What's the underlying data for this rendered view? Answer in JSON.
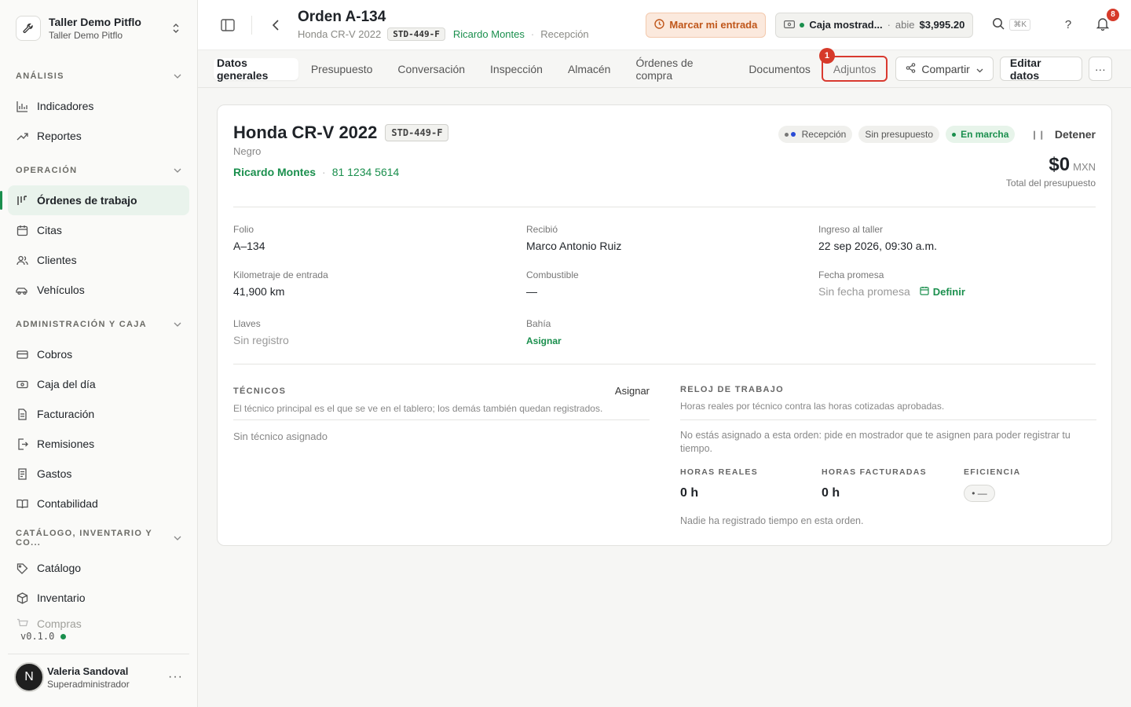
{
  "org": {
    "name": "Taller Demo Pitflo",
    "sub": "Taller Demo Pitflo"
  },
  "sidebar": {
    "sections": [
      {
        "title": "ANÁLISIS",
        "items": [
          {
            "label": "Indicadores",
            "icon": "bar-chart-icon"
          },
          {
            "label": "Reportes",
            "icon": "trend-up-icon"
          }
        ]
      },
      {
        "title": "OPERACIÓN",
        "items": [
          {
            "label": "Órdenes de trabajo",
            "icon": "kanban-icon",
            "active": true
          },
          {
            "label": "Citas",
            "icon": "calendar-icon"
          },
          {
            "label": "Clientes",
            "icon": "users-icon"
          },
          {
            "label": "Vehículos",
            "icon": "car-icon"
          }
        ]
      },
      {
        "title": "ADMINISTRACIÓN Y CAJA",
        "items": [
          {
            "label": "Cobros",
            "icon": "credit-card-icon"
          },
          {
            "label": "Caja del día",
            "icon": "cash-icon"
          },
          {
            "label": "Facturación",
            "icon": "document-icon"
          },
          {
            "label": "Remisiones",
            "icon": "file-export-icon"
          },
          {
            "label": "Gastos",
            "icon": "receipt-icon"
          },
          {
            "label": "Contabilidad",
            "icon": "book-icon"
          }
        ]
      },
      {
        "title": "CATÁLOGO, INVENTARIO Y CO...",
        "items": [
          {
            "label": "Catálogo",
            "icon": "tag-icon"
          },
          {
            "label": "Inventario",
            "icon": "box-icon"
          },
          {
            "label": "Compras",
            "icon": "cart-icon",
            "faded": true
          }
        ]
      }
    ],
    "version": "v0.1.0",
    "user": {
      "initial": "N",
      "name": "Valeria Sandoval",
      "role": "Superadministrador"
    }
  },
  "header": {
    "title": "Orden A-134",
    "vehicle": "Honda CR-V 2022",
    "plate": "STD-449-F",
    "customer": "Ricardo Montes",
    "stage": "Recepción",
    "entry_button": "Marcar mi entrada",
    "cash": {
      "name": "Caja mostrad...",
      "status": "abie",
      "amount": "$3,995.20"
    },
    "search_shortcut": "⌘K",
    "help": "?",
    "notifications": "8"
  },
  "tabs": [
    {
      "label": "Datos generales",
      "active": true
    },
    {
      "label": "Presupuesto"
    },
    {
      "label": "Conversación"
    },
    {
      "label": "Inspección"
    },
    {
      "label": "Almacén"
    },
    {
      "label": "Órdenes de compra"
    },
    {
      "label": "Documentos"
    },
    {
      "label": "Adjuntos",
      "highlight": true
    }
  ],
  "highlight_marker": "1",
  "actions": {
    "share": "Compartir",
    "edit": "Editar datos",
    "more": "···"
  },
  "card": {
    "vehicle": "Honda CR-V 2022",
    "plate": "STD-449-F",
    "color": "Negro",
    "customer": "Ricardo Montes",
    "phone": "81 1234 5614",
    "pills": {
      "stage": "Recepción",
      "budget": "Sin presupuesto",
      "status": "En marcha"
    },
    "stop": "Detener",
    "total": {
      "amount": "$0",
      "currency": "MXN",
      "label": "Total del presupuesto"
    },
    "fields": {
      "folio": {
        "label": "Folio",
        "value": "A–134"
      },
      "received": {
        "label": "Recibió",
        "value": "Marco Antonio Ruiz"
      },
      "entry": {
        "label": "Ingreso al taller",
        "value": "22 sep 2026, 09:30 a.m."
      },
      "mileage": {
        "label": "Kilometraje de entrada",
        "value": "41,900 km"
      },
      "fuel": {
        "label": "Combustible",
        "value": "—"
      },
      "promise": {
        "label": "Fecha promesa",
        "value": "Sin fecha promesa",
        "action": "Definir"
      },
      "keys": {
        "label": "Llaves",
        "value": "Sin registro"
      },
      "bay": {
        "label": "Bahía",
        "action": "Asignar"
      }
    },
    "techs": {
      "title": "TÉCNICOS",
      "assign": "Asignar",
      "help": "El técnico principal es el que se ve en el tablero; los demás también quedan registrados.",
      "empty": "Sin técnico asignado"
    },
    "clock": {
      "title": "RELOJ DE TRABAJO",
      "help": "Horas reales por técnico contra las horas cotizadas aprobadas.",
      "notice": "No estás asignado a esta orden: pide en mostrador que te asignen para poder registrar tu tiempo.",
      "real_label": "HORAS REALES",
      "real_value": "0 h",
      "billed_label": "HORAS FACTURADAS",
      "billed_value": "0 h",
      "eff_label": "EFICIENCIA",
      "eff_value": "• —",
      "footer": "Nadie ha registrado tiempo en esta orden."
    }
  }
}
